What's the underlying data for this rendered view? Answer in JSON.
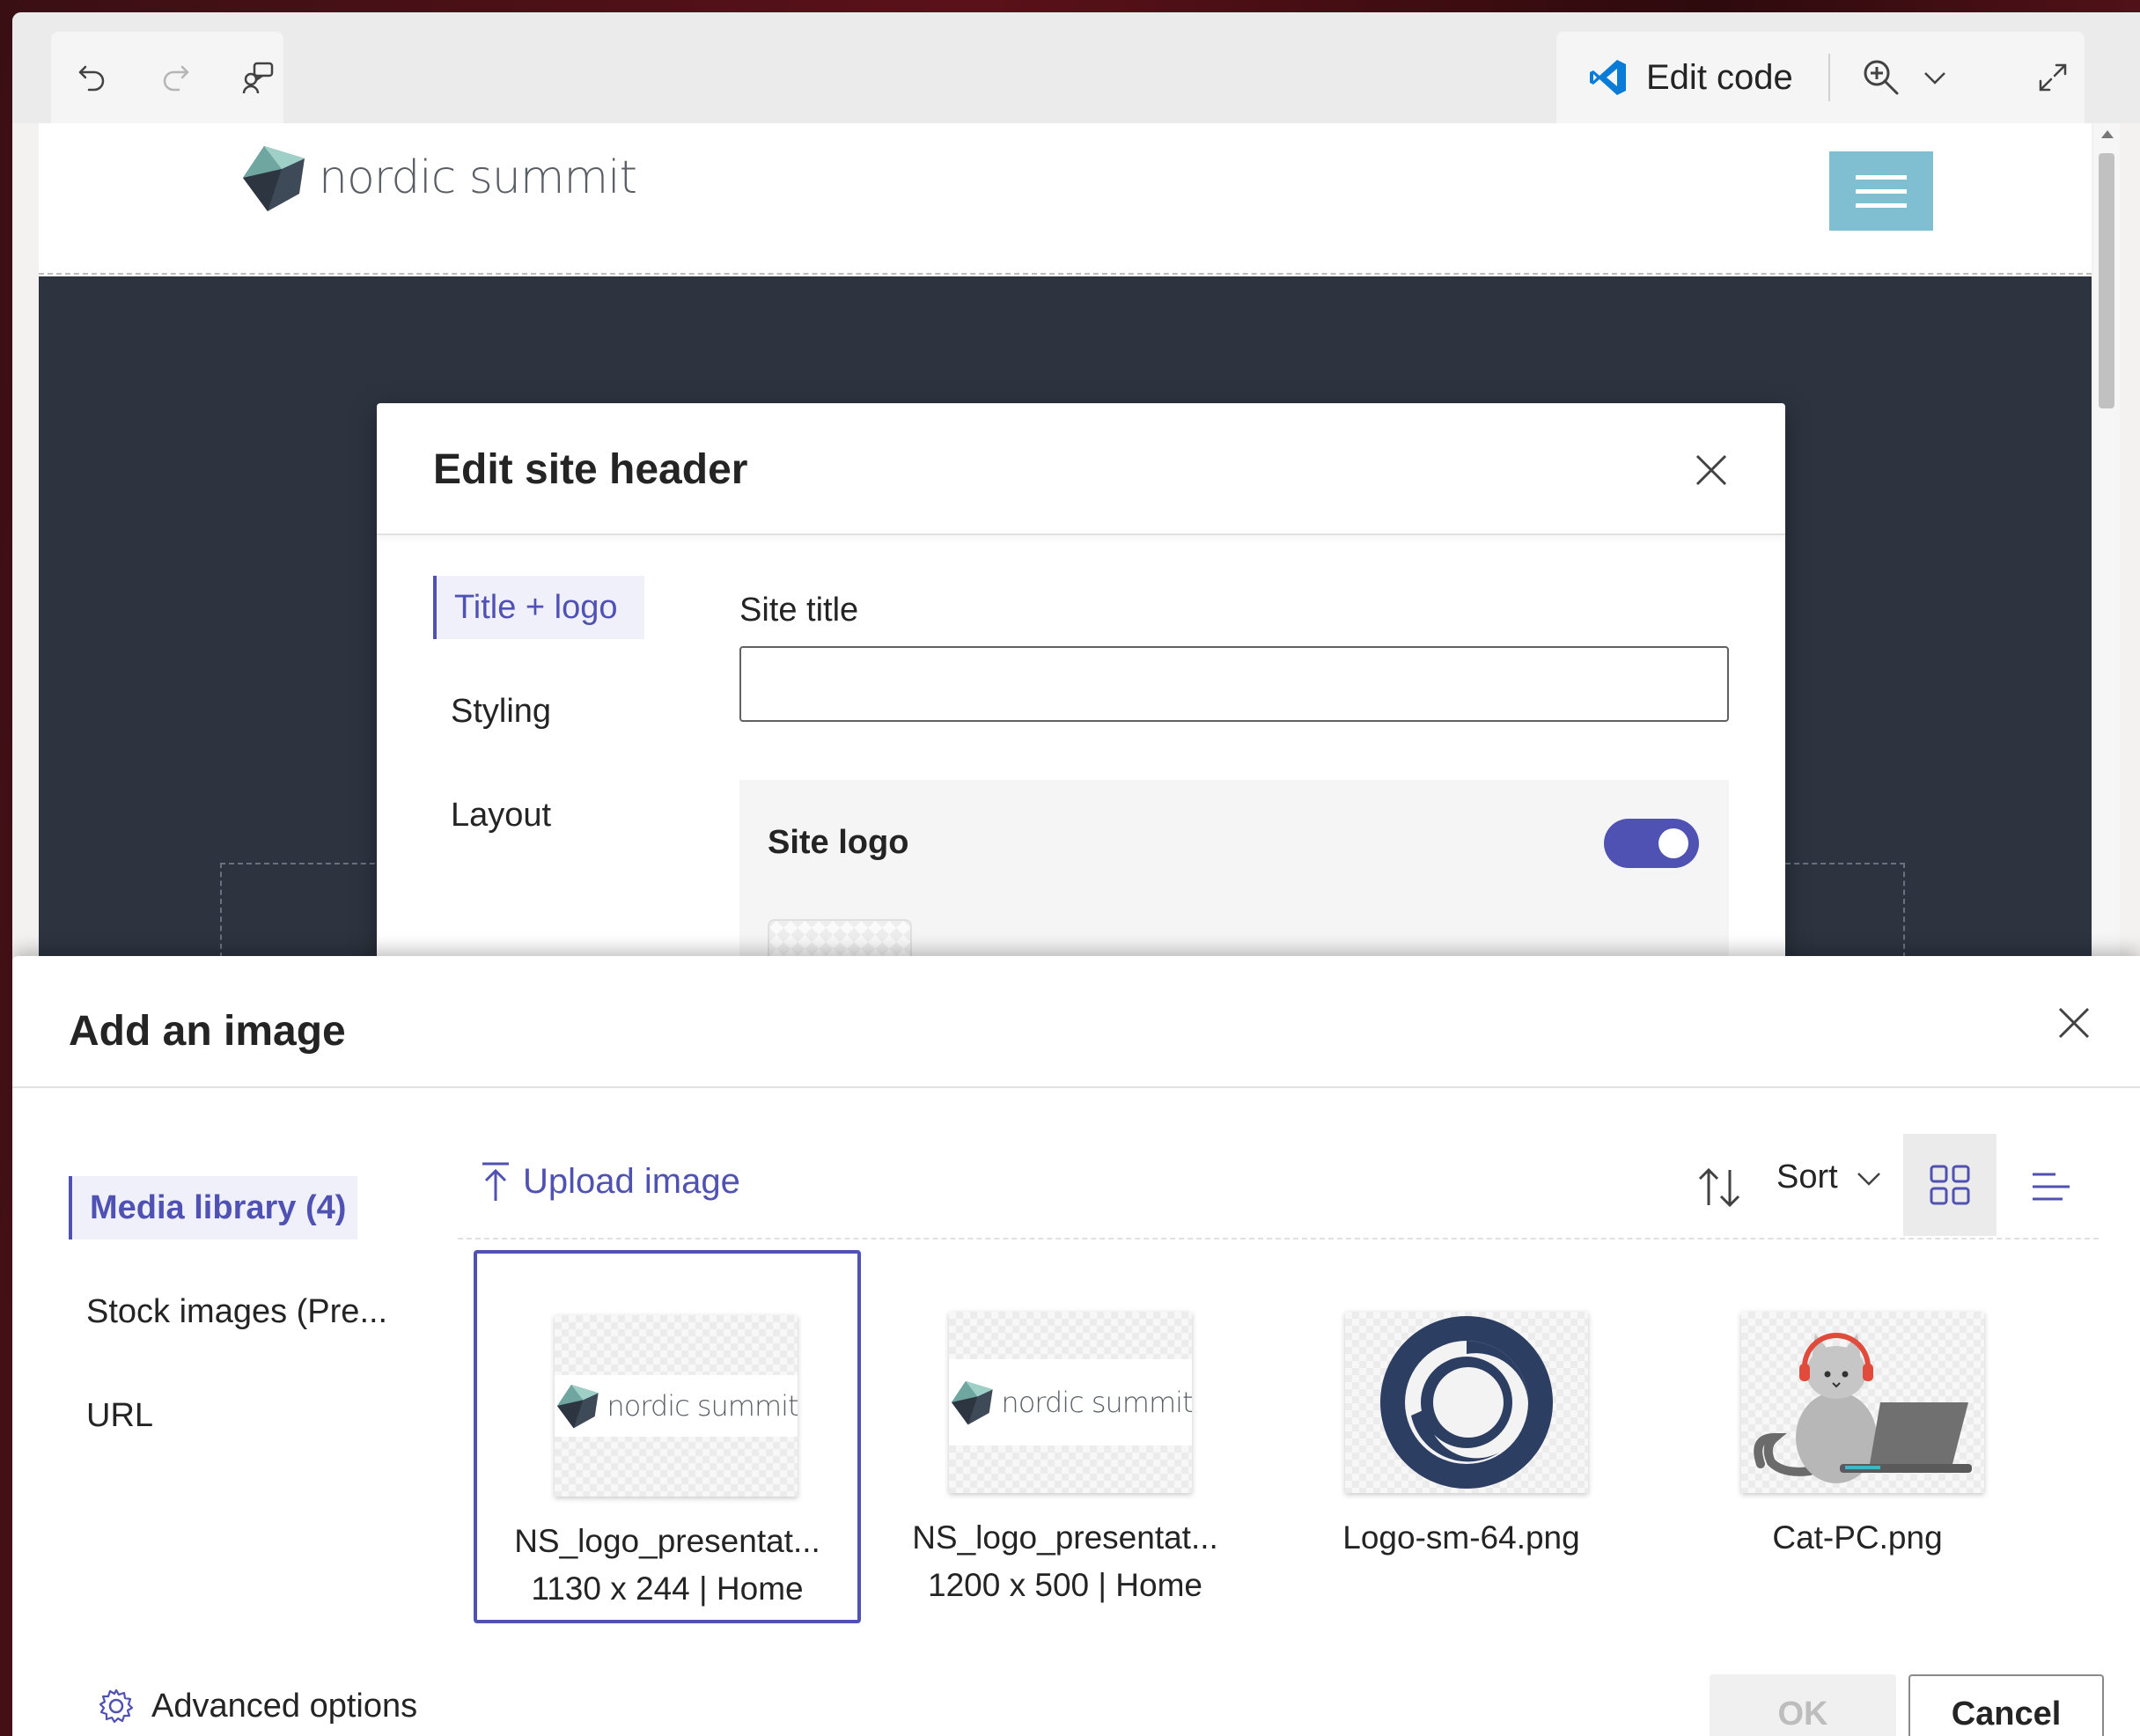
{
  "toolbar": {
    "undo_icon": "undo-icon",
    "redo_icon": "redo-icon",
    "comments_icon": "comments-icon",
    "edit_code_label": "Edit code",
    "zoom_icon": "zoom-in-icon",
    "expand_icon": "expand-icon"
  },
  "site": {
    "logo_text": "nordic summit",
    "menu_icon": "hamburger-menu-icon"
  },
  "edit_header_dialog": {
    "title": "Edit site header",
    "nav": [
      "Title + logo",
      "Styling",
      "Layout"
    ],
    "active_nav": "Title + logo",
    "site_title_label": "Site title",
    "site_title_value": "",
    "site_logo_label": "Site logo",
    "site_logo_enabled": true
  },
  "add_image_panel": {
    "title": "Add an image",
    "nav": [
      "Media library (4)",
      "Stock images (Pre...",
      "URL"
    ],
    "upload_label": "Upload image",
    "sort_label": "Sort",
    "view": "grid",
    "images": [
      {
        "name": "NS_logo_presentat...",
        "meta": "1130 x 244 | Home",
        "thumb": "nordic-summit-logo",
        "logo_text": "nordic summit",
        "selected": true
      },
      {
        "name": "NS_logo_presentat...",
        "meta": "1200 x 500 | Home",
        "thumb": "nordic-summit-logo",
        "logo_text": "nordic summit",
        "selected": false
      },
      {
        "name": "Logo-sm-64.png",
        "meta": "",
        "thumb": "circle-logo",
        "selected": false
      },
      {
        "name": "Cat-PC.png",
        "meta": "",
        "thumb": "cat-with-laptop",
        "selected": false
      }
    ],
    "advanced_label": "Advanced options",
    "ok_label": "OK",
    "cancel_label": "Cancel"
  },
  "colors": {
    "accent": "#4f52b2",
    "hamburger_bg": "#7fbfd1",
    "site_body": "#2d3440"
  }
}
